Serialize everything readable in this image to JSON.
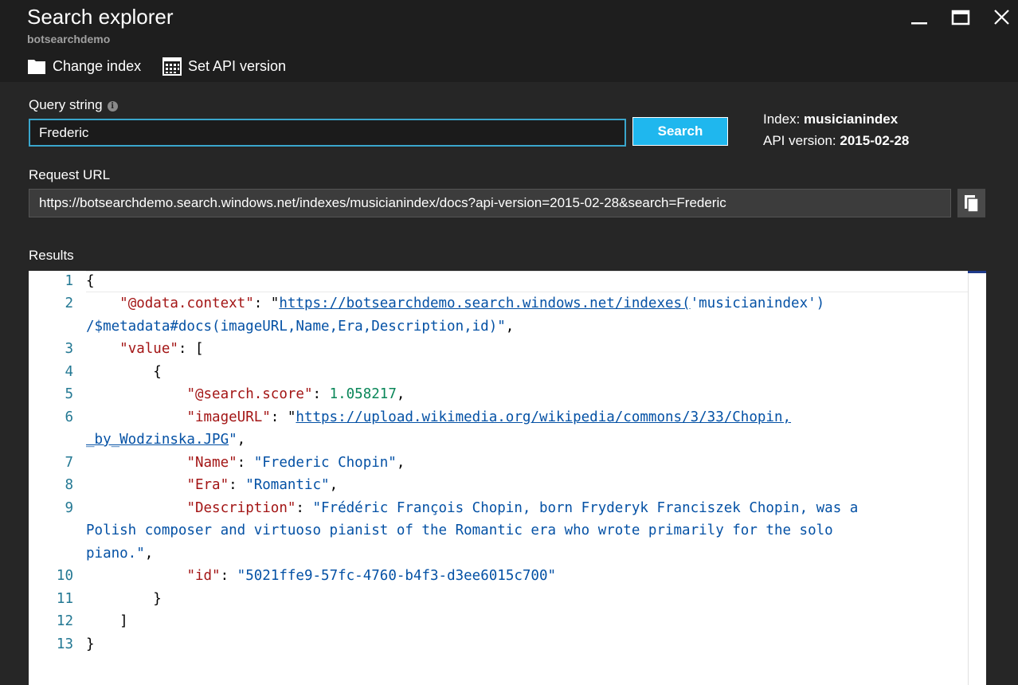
{
  "header": {
    "title": "Search explorer",
    "subtitle": "botsearchdemo",
    "commands": {
      "change_index": "Change index",
      "set_api_version": "Set API version"
    }
  },
  "query": {
    "label": "Query string",
    "value": "Frederic",
    "search_button": "Search"
  },
  "meta": {
    "index_label": "Index:",
    "index_value": "musicianindex",
    "api_label": "API version:",
    "api_value": "2015-02-28"
  },
  "request": {
    "label": "Request URL",
    "url": "https://botsearchdemo.search.windows.net/indexes/musicianindex/docs?api-version=2015-02-28&search=Frederic"
  },
  "results": {
    "label": "Results",
    "line_numbers": [
      "1",
      "2",
      "3",
      "4",
      "5",
      "6",
      "7",
      "8",
      "9",
      "10",
      "11",
      "12",
      "13"
    ],
    "json": {
      "odata_context_key": "\"@odata.context\"",
      "odata_context_url": "https://botsearchdemo.search.windows.net/indexes(",
      "odata_context_rest1": "'musicianindex')",
      "odata_context_rest2": "/$metadata#docs(imageURL,Name,Era,Description,id)\"",
      "value_key": "\"value\"",
      "score_key": "\"@search.score\"",
      "score_value": "1.058217",
      "image_key": "\"imageURL\"",
      "image_url_1": "https://upload.wikimedia.org/wikipedia/commons/3/33/Chopin,",
      "image_url_2": "_by_Wodzinska.JPG",
      "name_key": "\"Name\"",
      "name_value": "\"Frederic Chopin\"",
      "era_key": "\"Era\"",
      "era_value": "\"Romantic\"",
      "desc_key": "\"Description\"",
      "desc_value_1": "\"Frédéric François Chopin, born Fryderyk Franciszek Chopin, was a",
      "desc_value_2": "Polish composer and virtuoso pianist of the Romantic era who wrote primarily for the solo",
      "desc_value_3": "piano.\"",
      "id_key": "\"id\"",
      "id_value": "\"5021ffe9-57fc-4760-b4f3-d3ee6015c700\""
    }
  },
  "colors": {
    "accent": "#1fb7ee",
    "input_border": "#3aa6cc",
    "header_bg": "#1e1e1e",
    "body_bg": "#262626",
    "json_key": "#a31515",
    "json_string": "#0451a5",
    "json_number": "#098658",
    "line_number": "#237893"
  },
  "icons": [
    "minimize-icon",
    "maximize-icon",
    "close-icon",
    "folder-icon",
    "calendar-grid-icon",
    "info-icon",
    "copy-icon"
  ]
}
